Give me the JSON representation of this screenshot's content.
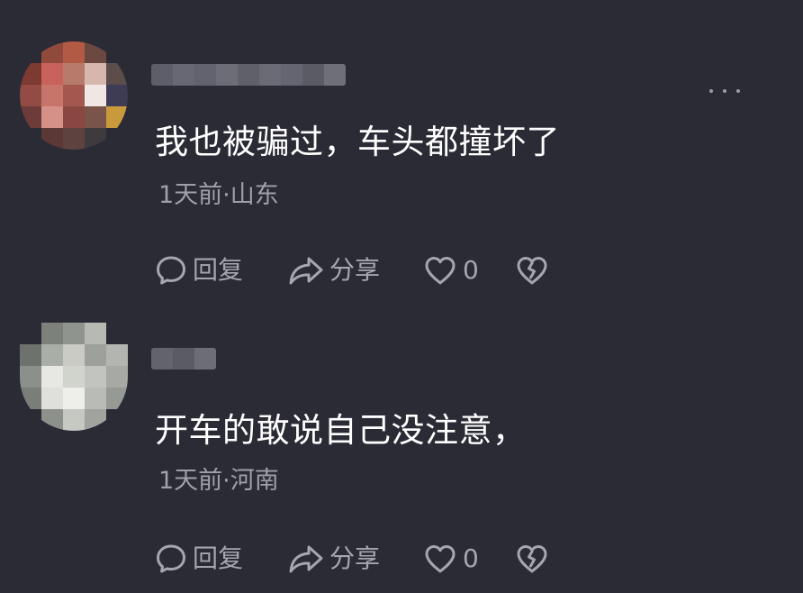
{
  "comments": [
    {
      "text": "我也被骗过，车头都撞坏了",
      "meta": "1天前·山东",
      "actions": {
        "reply_label": "回复",
        "share_label": "分享",
        "like_count": "0"
      }
    },
    {
      "text": "开车的敢说自己没注意，",
      "meta": "1天前·河南",
      "actions": {
        "reply_label": "回复",
        "share_label": "分享",
        "like_count": "0"
      }
    }
  ],
  "colors": {
    "background": "#2a2b35",
    "text": "#ffffff",
    "meta": "#9fa0aa",
    "action": "#a5a6af"
  },
  "icons": {
    "more": "more-dots-icon",
    "reply": "comment-bubble-icon",
    "share": "share-arrow-icon",
    "like": "heart-icon",
    "dislike": "broken-heart-icon"
  }
}
